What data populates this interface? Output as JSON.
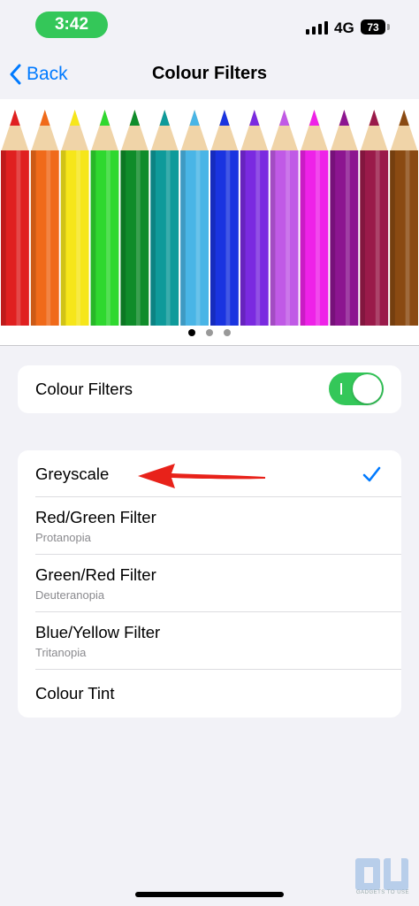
{
  "status_bar": {
    "time": "3:42",
    "network": "4G",
    "battery": "73",
    "time_pill_color": "#34c759"
  },
  "nav": {
    "back_label": "Back",
    "title": "Colour Filters",
    "accent_color": "#007aff"
  },
  "banner": {
    "pencil_colors": [
      "#e02020",
      "#f06a1a",
      "#f6e61a",
      "#2fd82f",
      "#0f8c2a",
      "#0e9a9a",
      "#49b5e6",
      "#1a34e0",
      "#7a2ae0",
      "#c05ae6",
      "#ee22e8",
      "#8c1590",
      "#9a1a4a",
      "#8a4a12"
    ],
    "page_count": 3,
    "active_page": 1
  },
  "toggle_section": {
    "label": "Colour Filters",
    "enabled": true,
    "toggle_color": "#34c759"
  },
  "filters": [
    {
      "title": "Greyscale",
      "subtitle": "",
      "selected": true
    },
    {
      "title": "Red/Green Filter",
      "subtitle": "Protanopia",
      "selected": false
    },
    {
      "title": "Green/Red Filter",
      "subtitle": "Deuteranopia",
      "selected": false
    },
    {
      "title": "Blue/Yellow Filter",
      "subtitle": "Tritanopia",
      "selected": false
    },
    {
      "title": "Colour Tint",
      "subtitle": "",
      "selected": false
    }
  ],
  "annotation": {
    "arrow_color": "#e8221a"
  },
  "watermark": {
    "text": "GADGETS TO USE"
  }
}
